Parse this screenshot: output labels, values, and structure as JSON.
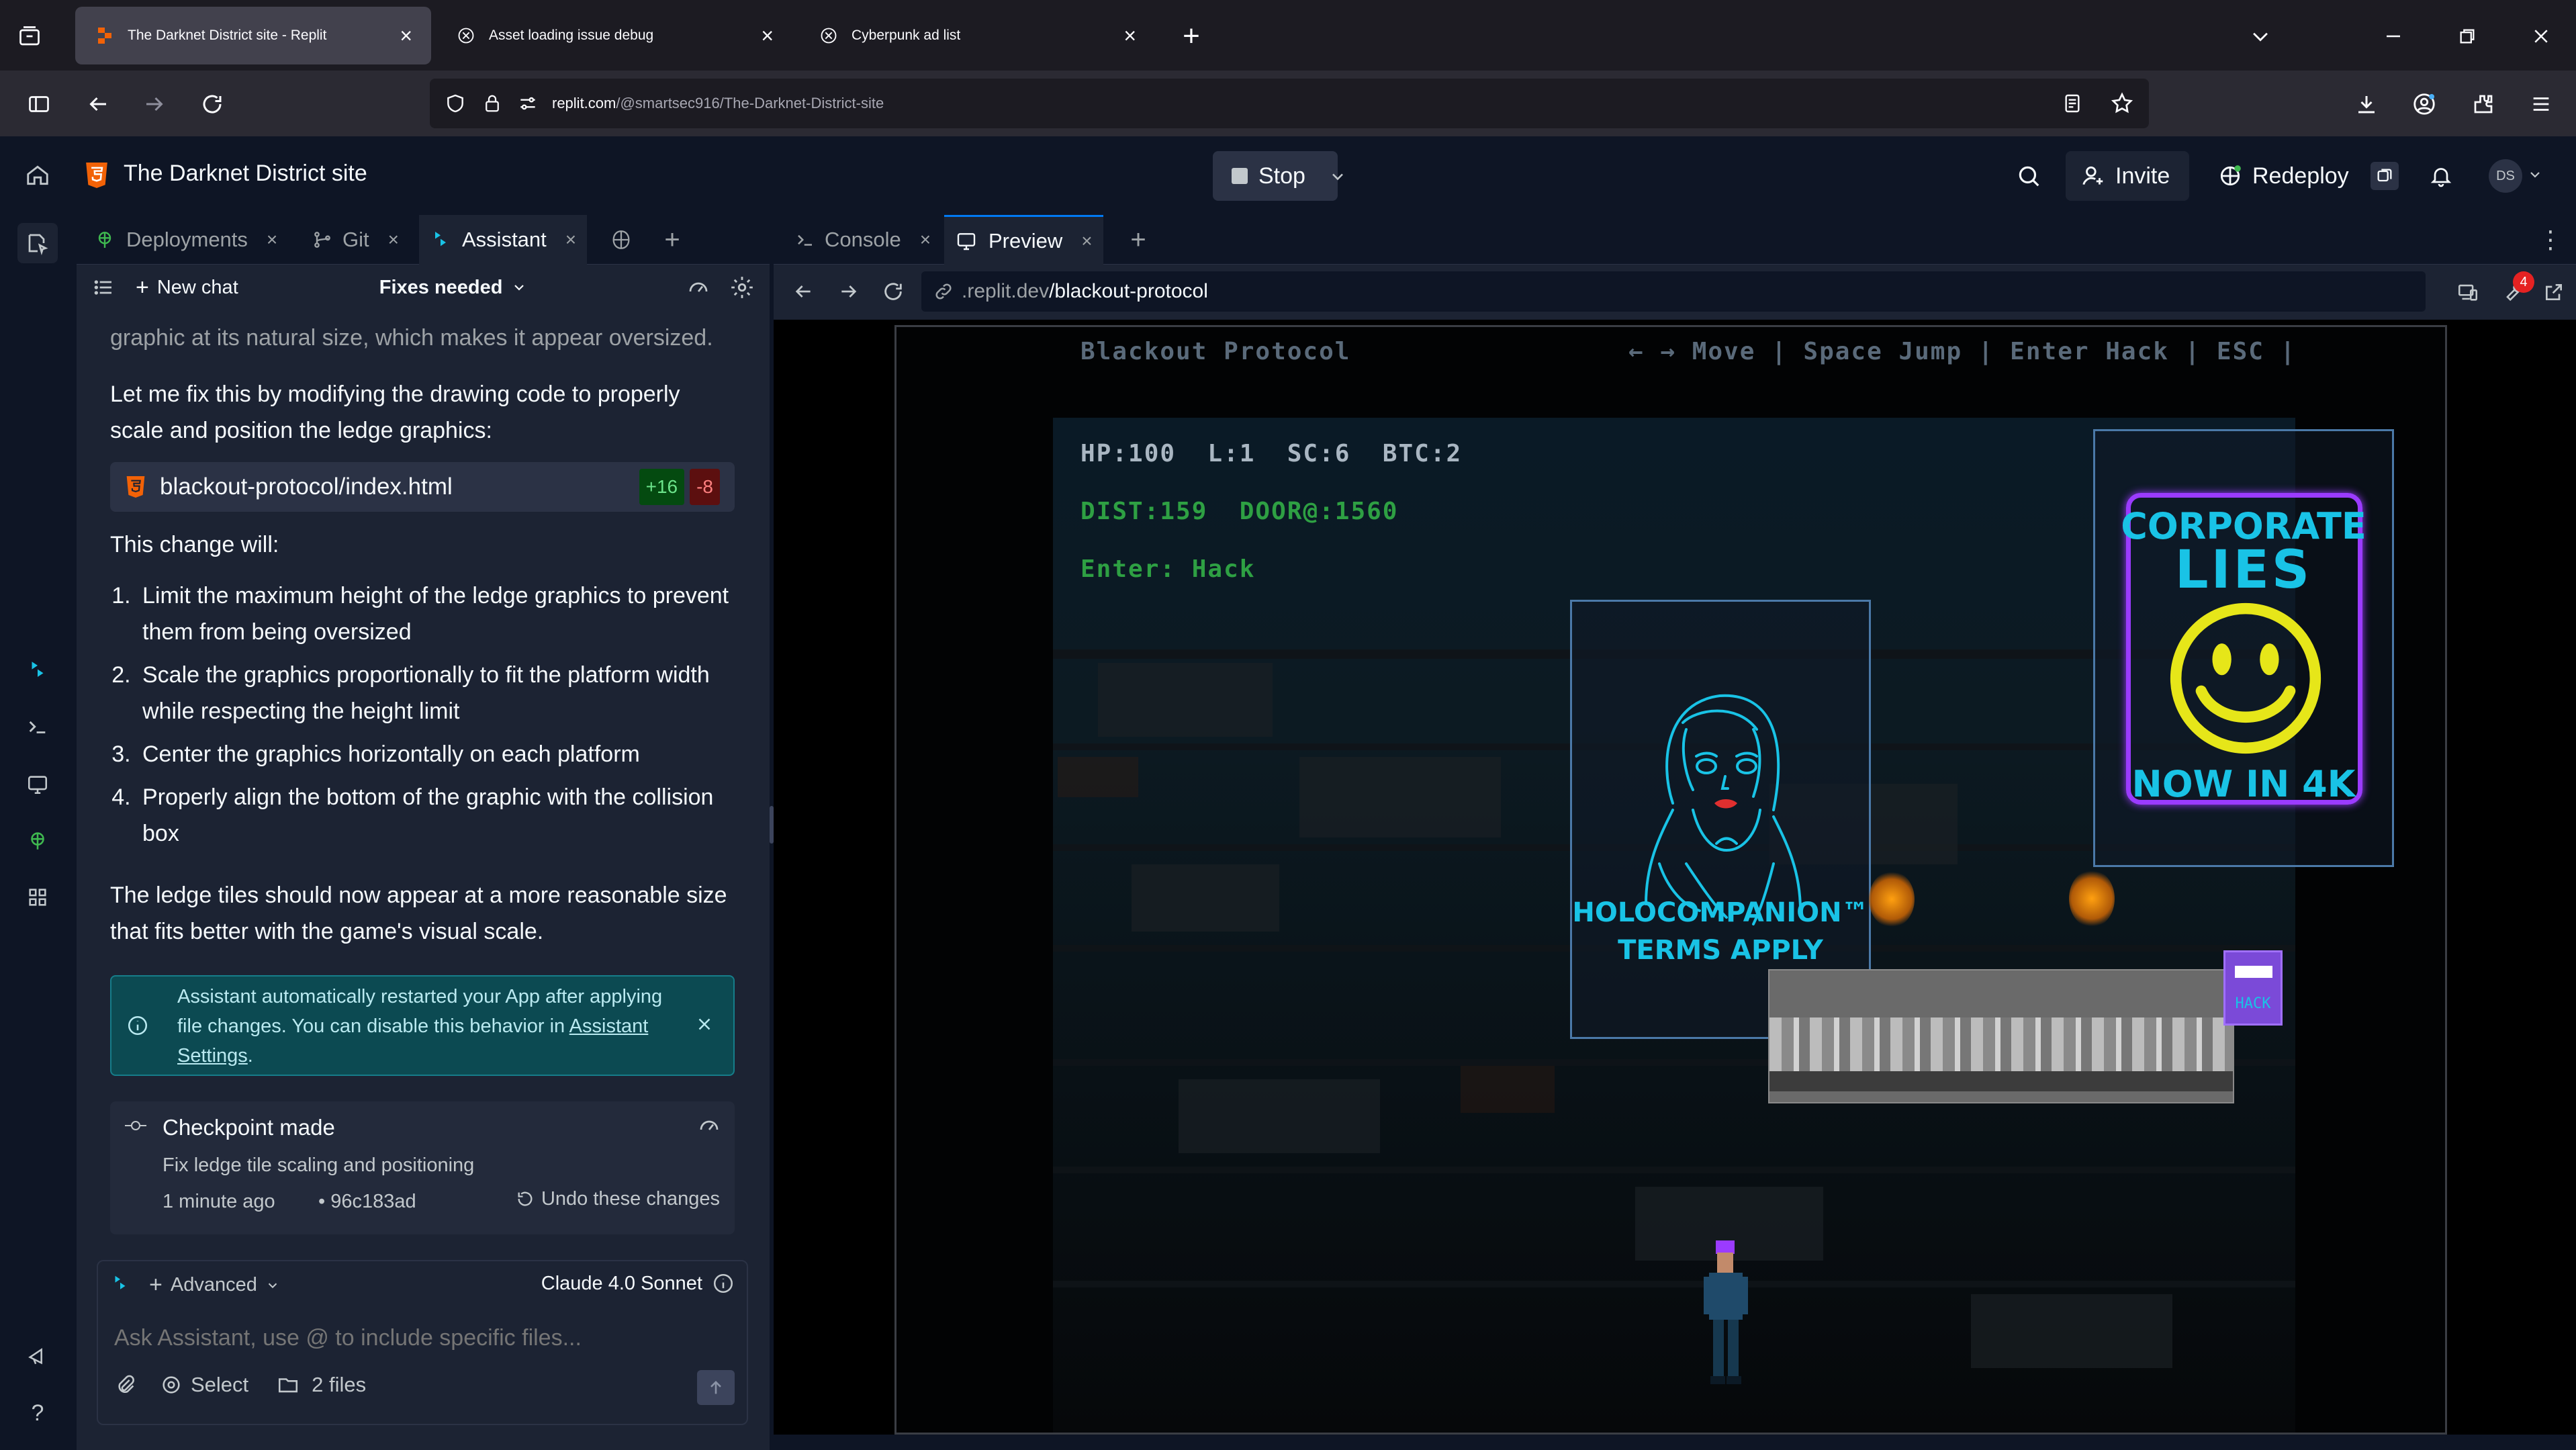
{
  "browser": {
    "tabs": [
      {
        "title": "The Darknet District site - Replit",
        "active": true
      },
      {
        "title": "Asset loading issue debug",
        "active": false
      },
      {
        "title": "Cyberpunk ad list",
        "active": false
      }
    ],
    "url_host": "replit.com",
    "url_path": "/@smartsec916/The-Darknet-District-site"
  },
  "header": {
    "project_title": "The Darknet District site",
    "stop_label": "Stop",
    "invite_label": "Invite",
    "redeploy_label": "Redeploy",
    "avatar_initials": "DS"
  },
  "pane_tabs": [
    {
      "label": "Deployments"
    },
    {
      "label": "Git"
    },
    {
      "label": "Assistant"
    }
  ],
  "assistant": {
    "new_chat_label": "New chat",
    "chat_title": "Fixes needed",
    "faded_text": "graphic at its natural size, which makes it appear oversized.",
    "intro": "Let me fix this by modifying the drawing code to properly scale and position the ledge graphics:",
    "file_chip": {
      "name": "blackout-protocol/index.html",
      "added": "+16",
      "removed": "-8"
    },
    "change_heading": "This change will:",
    "changes": [
      "Limit the maximum height of the ledge graphics to prevent them from being oversized",
      "Scale the graphics proportionally to fit the platform width while respecting the height limit",
      "Center the graphics horizontally on each platform",
      "Properly align the bottom of the graphic with the collision box"
    ],
    "conclusion": "The ledge tiles should now appear at a more reasonable size that fits better with the game's visual scale.",
    "notice_text": "Assistant automatically restarted your App after applying file changes. You can disable this behavior in",
    "notice_link": "Assistant Settings",
    "notice_end": ".",
    "checkpoint": {
      "title": "Checkpoint made",
      "description": "Fix ledge tile scaling and positioning",
      "time": "1 minute ago",
      "hash": "• 96c183ad",
      "undo_label": "Undo these changes"
    },
    "composer": {
      "mode_label": "Advanced",
      "model_label": "Claude 4.0 Sonnet",
      "placeholder": "Ask Assistant, use @ to include specific files...",
      "select_label": "Select",
      "files_label": "2 files"
    }
  },
  "right_tabs": [
    {
      "label": "Console"
    },
    {
      "label": "Preview"
    }
  ],
  "preview": {
    "url_dim": ".replit.dev",
    "url_path": "/blackout-protocol",
    "notification_count": "4"
  },
  "game": {
    "title": "Blackout Protocol",
    "controls": "← → Move | Space Jump | Enter Hack | ESC |",
    "stats_line1": "HP:100  L:1  SC:6  BTC:2",
    "stats_line2": "DIST:159  DOOR@:1560",
    "stats_line3": "Enter: Hack",
    "sign_holo_line1": "HOLOCOMPANION™",
    "sign_holo_line2": "TERMS APPLY",
    "sign_corp_line1": "CORPORATE",
    "sign_corp_line2": "LIES",
    "sign_corp_line3": "NOW IN 4K",
    "terminal_label": "HACK"
  },
  "colors": {
    "replit_bg": "#0e1525",
    "panel": "#1c2333",
    "hud_green": "#2ea043",
    "neon_cyan": "#19c3e6",
    "neon_purple": "#9b3bff",
    "neon_yellow": "#e6e619"
  }
}
